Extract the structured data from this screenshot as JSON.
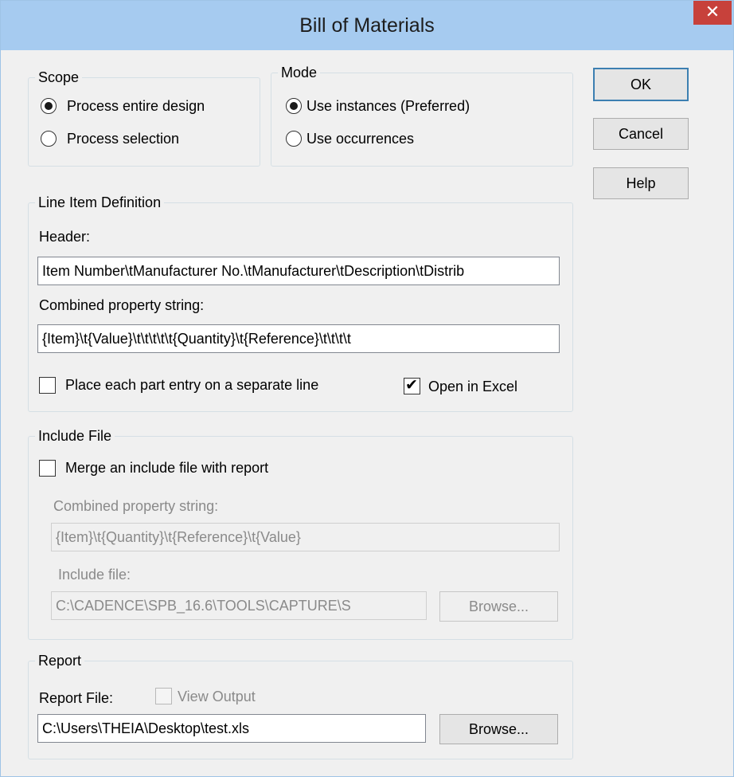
{
  "window": {
    "title": "Bill of Materials",
    "close_label": "✕"
  },
  "scope": {
    "legend": "Scope",
    "options": [
      "Process entire design",
      "Process selection"
    ],
    "selected": 0
  },
  "mode": {
    "legend": "Mode",
    "options": [
      "Use instances (Preferred)",
      "Use occurrences"
    ],
    "selected": 0
  },
  "buttons": {
    "ok": "OK",
    "cancel": "Cancel",
    "help": "Help"
  },
  "line_item": {
    "legend": "Line Item Definition",
    "header_label": "Header:",
    "header_value": "Item Number\\tManufacturer No.\\tManufacturer\\tDescription\\tDistrib",
    "combined_label": "Combined property string:",
    "combined_value": "{Item}\\t{Value}\\t\\t\\t\\t\\t{Quantity}\\t{Reference}\\t\\t\\t\\t",
    "separate_line_label": "Place each part entry on a separate line",
    "separate_line_checked": false,
    "open_excel_label": "Open in Excel",
    "open_excel_checked": true
  },
  "include_file": {
    "legend": "Include File",
    "merge_label": "Merge an include file with report",
    "merge_checked": false,
    "combined_label": "Combined property string:",
    "combined_value": "{Item}\\t{Quantity}\\t{Reference}\\t{Value}",
    "file_label": "Include file:",
    "file_value": "C:\\CADENCE\\SPB_16.6\\TOOLS\\CAPTURE\\S",
    "browse_label": "Browse..."
  },
  "report": {
    "legend": "Report",
    "file_label": "Report File:",
    "view_output_label": "View Output",
    "view_output_checked": false,
    "file_value": "C:\\Users\\THEIA\\Desktop\\test.xls",
    "browse_label": "Browse..."
  },
  "colors": {
    "titlebar": "#a6cbf0",
    "close_button": "#c7413b",
    "default_button_border": "#3c7fb1",
    "dialog_background": "#f0f0f0"
  }
}
